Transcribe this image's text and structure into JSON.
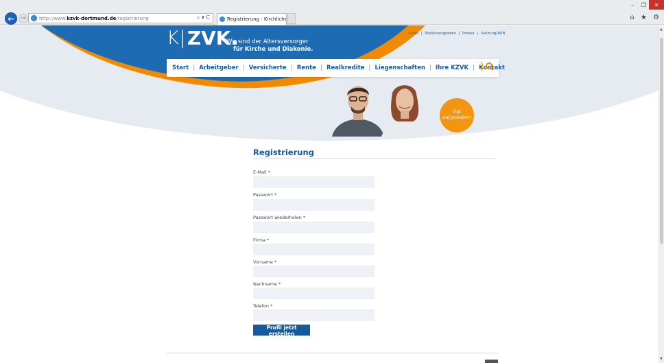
{
  "browser": {
    "url_prefix": "http://www.",
    "url_host": "kzvk-dortmund.de",
    "url_path": "/registrierung",
    "addr_tools": "⌕ ▾ C",
    "tab_title": "Registrierung - Kirchliche Z...",
    "tab_close": "×",
    "win_min": "–",
    "win_max": "❐",
    "win_close": "✕",
    "right_icons": "⌂ ★ ⚙"
  },
  "site": {
    "logo_k": "K",
    "logo_bar": "|",
    "logo_zvk": "ZVK",
    "tagline_line1": "Wir sind der Altersversorger",
    "tagline_line2": "für Kirche und Diakonie.",
    "util_links": [
      "Links",
      "Stellenangebote",
      "Presse",
      "Satzung/AVB"
    ],
    "util_sep": "|",
    "nav": [
      "Start",
      "Arbeitgeber",
      "Versicherte",
      "Rente",
      "Realkredite",
      "Liegenschaften",
      "Ihre KZVK",
      "Kontakt"
    ],
    "nav_sep": "|",
    "badge_line1": "Gut",
    "badge_line2": "aufgehoben"
  },
  "form": {
    "title": "Registrierung",
    "fields": [
      {
        "label": "E-Mail *",
        "value": ""
      },
      {
        "label": "Passwort *",
        "value": ""
      },
      {
        "label": "Passwort wiederholen *",
        "value": ""
      },
      {
        "label": "Firma *",
        "value": ""
      },
      {
        "label": "Vorname *",
        "value": ""
      },
      {
        "label": "Nachname *",
        "value": ""
      },
      {
        "label": "Telefon *",
        "value": ""
      }
    ],
    "submit_label": "Profil jetzt erstellen"
  },
  "colors": {
    "brand_blue": "#145a9c",
    "hero_blue": "#1d6bb3",
    "accent_orange": "#f08a00",
    "input_bg": "#eef2f8"
  }
}
